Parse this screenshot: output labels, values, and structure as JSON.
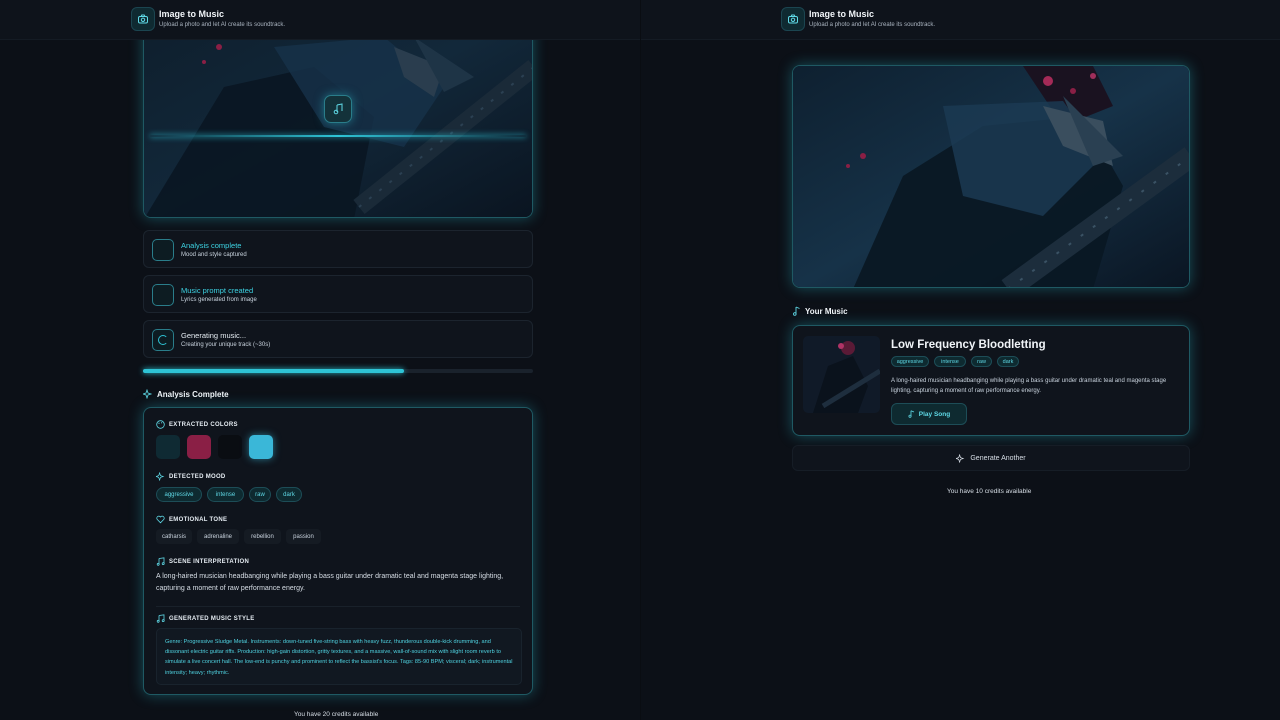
{
  "app": {
    "title": "Image to Music",
    "subtitle": "Upload a photo and let AI create its soundtrack."
  },
  "left": {
    "steps": [
      {
        "title": "Analysis complete",
        "subtitle": "Mood and style captured"
      },
      {
        "title": "Music prompt created",
        "subtitle": "Lyrics generated from image"
      },
      {
        "title": "Generating music...",
        "subtitle": "Creating your unique track (~30s)"
      }
    ],
    "progress": 0.67,
    "analysis_title": "Analysis Complete",
    "extracted_colors_label": "EXTRACTED COLORS",
    "colors": [
      "#0f2a33",
      "#8a1f45",
      "#0a0d12",
      "#3ab7d8"
    ],
    "detected_mood_label": "DETECTED MOOD",
    "moods": [
      "aggressive",
      "intense",
      "raw",
      "dark"
    ],
    "emotional_tone_label": "EMOTIONAL TONE",
    "tones": [
      "catharsis",
      "adrenaline",
      "rebellion",
      "passion"
    ],
    "scene_label": "SCENE INTERPRETATION",
    "scene_text": "A long-haired musician headbanging while playing a bass guitar under dramatic teal and magenta stage lighting, capturing a moment of raw performance energy.",
    "music_style_label": "GENERATED MUSIC STYLE",
    "music_style_text": "Genre: Progressive Sludge Metal. Instruments: down-tuned five-string bass with heavy fuzz, thunderous double-kick drumming, and dissonant electric guitar riffs. Production: high-gain distortion, gritty textures, and a massive, wall-of-sound mix with slight room reverb to simulate a live concert hall. The low-end is punchy and prominent to reflect the bassist's focus. Tags: 85-90 BPM; visceral; dark; instrumental intensity; heavy; rhythmic.",
    "credits": "You have 20 credits available"
  },
  "right": {
    "your_music_label": "Your Music",
    "song_title": "Low Frequency Bloodletting",
    "tags": [
      "aggressive",
      "intense",
      "raw",
      "dark"
    ],
    "description": "A long-haired musician headbanging while playing a bass guitar under dramatic teal and magenta stage lighting, capturing a moment of raw performance energy.",
    "play_label": "Play Song",
    "generate_another_label": "Generate Another",
    "credits": "You have 10 credits available"
  }
}
